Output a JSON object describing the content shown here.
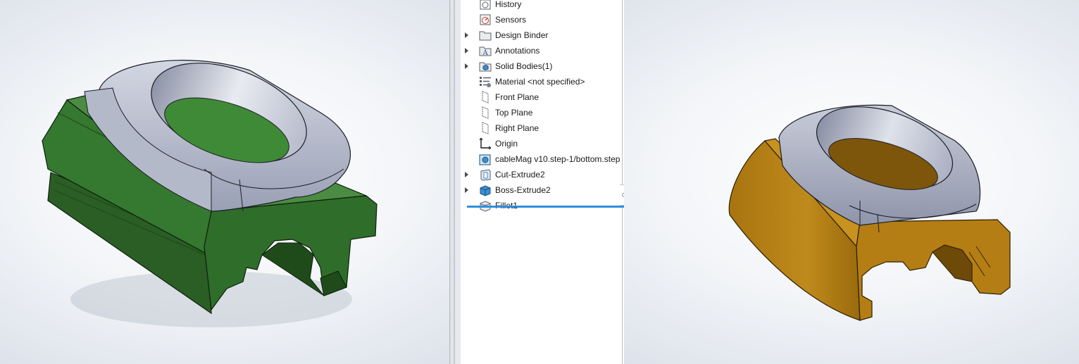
{
  "feature_tree": {
    "items": [
      {
        "label": "History",
        "icon": "history-icon",
        "expandable": false
      },
      {
        "label": "Sensors",
        "icon": "sensors-icon",
        "expandable": false
      },
      {
        "label": "Design Binder",
        "icon": "design-binder-icon",
        "expandable": true
      },
      {
        "label": "Annotations",
        "icon": "annotations-icon",
        "expandable": true
      },
      {
        "label": "Solid Bodies(1)",
        "icon": "solid-bodies-icon",
        "expandable": true
      },
      {
        "label": "Material <not specified>",
        "icon": "material-icon",
        "expandable": false
      },
      {
        "label": "Front Plane",
        "icon": "plane-icon",
        "expandable": false
      },
      {
        "label": "Top Plane",
        "icon": "plane-icon",
        "expandable": false
      },
      {
        "label": "Right Plane",
        "icon": "plane-icon",
        "expandable": false
      },
      {
        "label": "Origin",
        "icon": "origin-icon",
        "expandable": false
      },
      {
        "label": "cableMag v10.step-1/bottom.step",
        "icon": "imported-body-icon",
        "expandable": false
      },
      {
        "label": "Cut-Extrude2",
        "icon": "cut-extrude-icon",
        "expandable": true
      },
      {
        "label": "Boss-Extrude2",
        "icon": "boss-extrude-icon",
        "expandable": true
      },
      {
        "label": "Fillet1",
        "icon": "fillet-icon",
        "expandable": false
      }
    ]
  },
  "models": {
    "left": {
      "base_color": "#2e6b2a",
      "top_color": "#a9afc2"
    },
    "right": {
      "base_color": "#b07a12",
      "top_color": "#a9afc2"
    }
  },
  "accent": {
    "rollback_bar": "#2f8fdc"
  }
}
